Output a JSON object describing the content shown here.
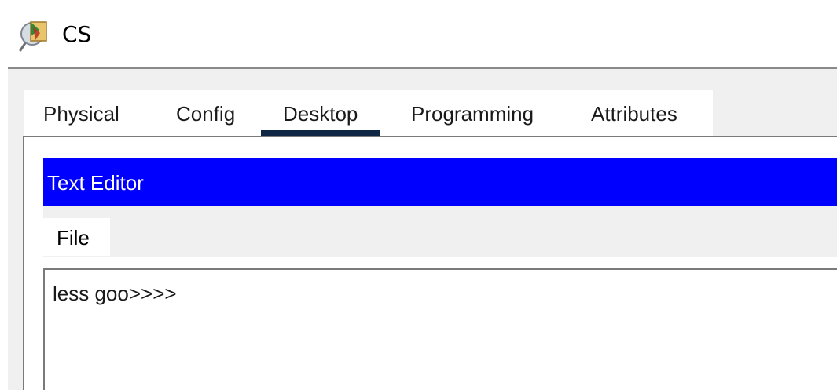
{
  "window": {
    "title": "CS",
    "icon": "packet-tracer-device-icon"
  },
  "tabs": [
    {
      "label": "Physical",
      "active": false
    },
    {
      "label": "Config",
      "active": false
    },
    {
      "label": "Desktop",
      "active": true
    },
    {
      "label": "Programming",
      "active": false
    },
    {
      "label": "Attributes",
      "active": false
    }
  ],
  "editor": {
    "title": "Text Editor",
    "menu": {
      "file_label": "File"
    },
    "content": "less goo>>>>"
  },
  "colors": {
    "editor_header": "#0000ff",
    "active_tab_underline": "#0f2744",
    "background": "#f0f0f0"
  }
}
